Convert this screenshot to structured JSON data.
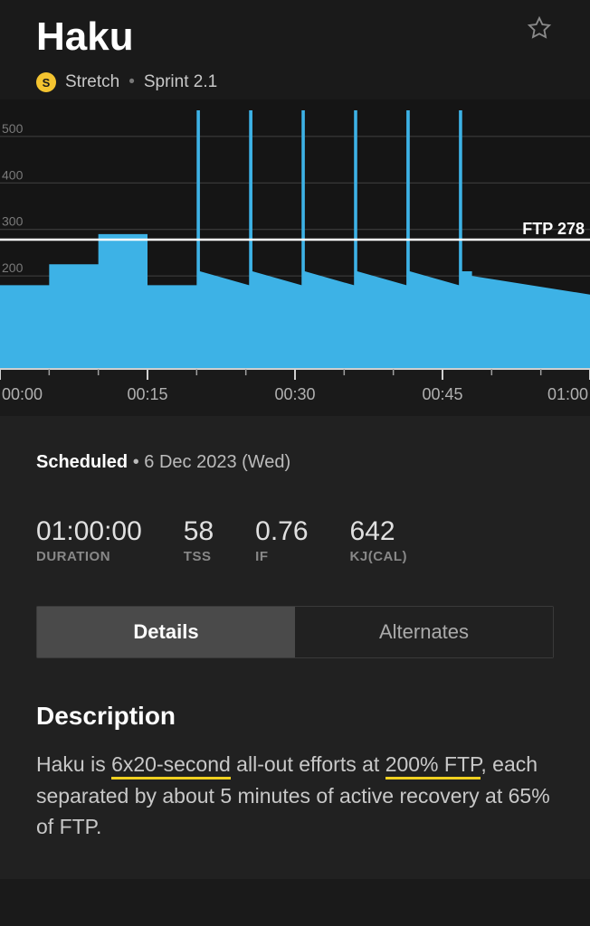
{
  "header": {
    "title": "Haku",
    "badge_letter": "S",
    "tag": "Stretch",
    "plan": "Sprint 2.1"
  },
  "scheduled": {
    "label": "Scheduled",
    "date": "6 Dec 2023 (Wed)"
  },
  "stats": {
    "duration_val": "01:00:00",
    "duration_lbl": "DURATION",
    "tss_val": "58",
    "tss_lbl": "TSS",
    "if_val": "0.76",
    "if_lbl": "IF",
    "kj_val": "642",
    "kj_lbl": "KJ(CAL)"
  },
  "tabs": {
    "details": "Details",
    "alternates": "Alternates",
    "active": "details"
  },
  "description": {
    "title": "Description",
    "text_before": "Haku is ",
    "hl1": "6x20-second",
    "text_mid1": " all-out efforts at ",
    "hl2": "200% FTP",
    "text_after": ", each separated by about 5 minutes of active recovery at 65% of FTP."
  },
  "chart_data": {
    "type": "area",
    "ftp": 278,
    "ftp_label": "FTP 278",
    "y_ticks": [
      200,
      300,
      400,
      500
    ],
    "x_ticks": [
      "00:00",
      "00:15",
      "00:30",
      "00:45",
      "01:00"
    ],
    "x_range_minutes": [
      0,
      60
    ],
    "y_range": [
      0,
      560
    ],
    "intervals_power_vs_time_min": [
      {
        "from": 0,
        "to": 5,
        "watts": 180
      },
      {
        "from": 5,
        "to": 10,
        "watts": 225
      },
      {
        "from": 10,
        "to": 15,
        "watts": 290
      },
      {
        "from": 15,
        "to": 20,
        "watts": 180
      },
      {
        "from": 20,
        "to": 20.33,
        "watts": 556
      },
      {
        "from": 20.33,
        "to": 25.33,
        "watts_start": 210,
        "watts_end": 180
      },
      {
        "from": 25.33,
        "to": 25.67,
        "watts": 556
      },
      {
        "from": 25.67,
        "to": 30.67,
        "watts_start": 210,
        "watts_end": 180
      },
      {
        "from": 30.67,
        "to": 31,
        "watts": 556
      },
      {
        "from": 31,
        "to": 36,
        "watts_start": 210,
        "watts_end": 180
      },
      {
        "from": 36,
        "to": 36.33,
        "watts": 556
      },
      {
        "from": 36.33,
        "to": 41.33,
        "watts_start": 210,
        "watts_end": 180
      },
      {
        "from": 41.33,
        "to": 41.67,
        "watts": 556
      },
      {
        "from": 41.67,
        "to": 46.67,
        "watts_start": 210,
        "watts_end": 180
      },
      {
        "from": 46.67,
        "to": 47,
        "watts": 556
      },
      {
        "from": 47,
        "to": 48,
        "watts": 210
      },
      {
        "from": 48,
        "to": 60,
        "watts_start": 200,
        "watts_end": 160
      }
    ],
    "colors": {
      "power": "#3db2e6",
      "grid": "#414141",
      "ftp_line": "#ffffff"
    }
  }
}
